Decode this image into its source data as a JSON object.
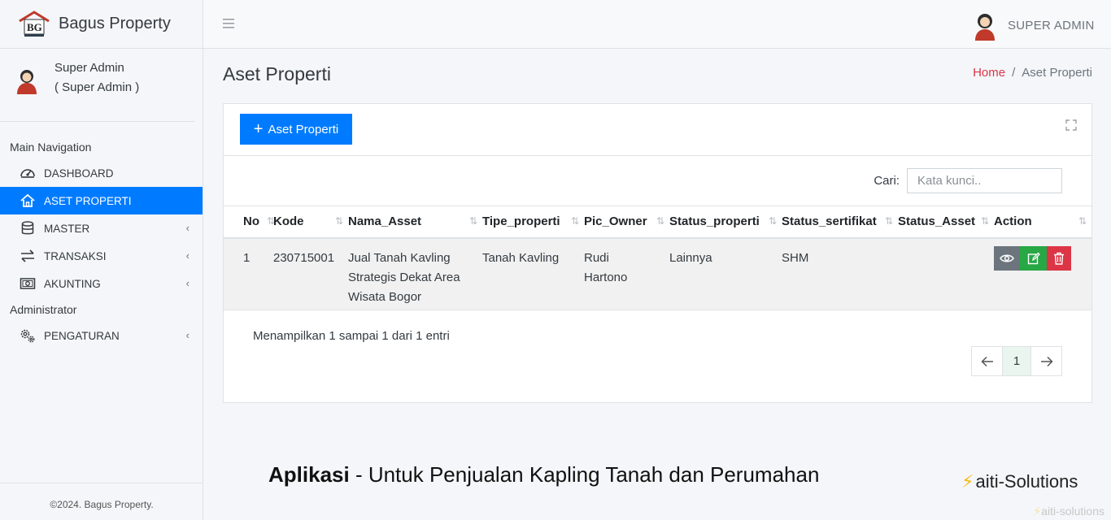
{
  "brand": {
    "name": "Bagus Property"
  },
  "user_panel": {
    "name": "Super Admin",
    "role": "( Super Admin )"
  },
  "nav": {
    "main_header": "Main Navigation",
    "admin_header": "Administrator",
    "items": [
      {
        "label": "DASHBOARD",
        "icon": "gauge-icon"
      },
      {
        "label": "ASET PROPERTI",
        "icon": "home-icon"
      },
      {
        "label": "MASTER",
        "icon": "database-icon"
      },
      {
        "label": "TRANSAKSI",
        "icon": "exchange-icon"
      },
      {
        "label": "AKUNTING",
        "icon": "money-icon"
      }
    ],
    "settings": {
      "label": "PENGATURAN",
      "icon": "gears-icon"
    }
  },
  "footer": {
    "text": "©2024. Bagus Property."
  },
  "topbar": {
    "user": "SUPER ADMIN"
  },
  "page": {
    "title": "Aset Properti"
  },
  "breadcrumb": {
    "home": "Home",
    "sep": "/",
    "current": "Aset Properti"
  },
  "card": {
    "add_label": "Aset Properti",
    "search_label": "Cari:",
    "search_placeholder": "Kata kunci.."
  },
  "table": {
    "columns": [
      "No",
      "Kode",
      "Nama_Asset",
      "Tipe_properti",
      "Pic_Owner",
      "Status_properti",
      "Status_sertifikat",
      "Status_Asset",
      "Action"
    ],
    "rows": [
      {
        "no": "1",
        "kode": "230715001",
        "nama": [
          "Jual Tanah Kavling",
          "Strategis Dekat Area",
          "Wisata Bogor"
        ],
        "tipe": "Tanah Kavling",
        "owner": [
          "Rudi",
          "Hartono"
        ],
        "status_properti": "Lainnya",
        "status_sertifikat": "SHM",
        "status_asset": ""
      }
    ]
  },
  "info": "Menampilkan 1 sampai 1 dari 1 entri",
  "pager": {
    "current": "1"
  },
  "promo": {
    "bold": "Aplikasi",
    "rest": " - Untuk Penjualan Kapling Tanah dan Perumahan"
  },
  "vendor": {
    "name": "aiti-Solutions",
    "watermark": "aiti-solutions"
  },
  "colors": {
    "primary": "#007bff",
    "success": "#28a745",
    "danger": "#dc3545",
    "secondary": "#6c757d"
  }
}
